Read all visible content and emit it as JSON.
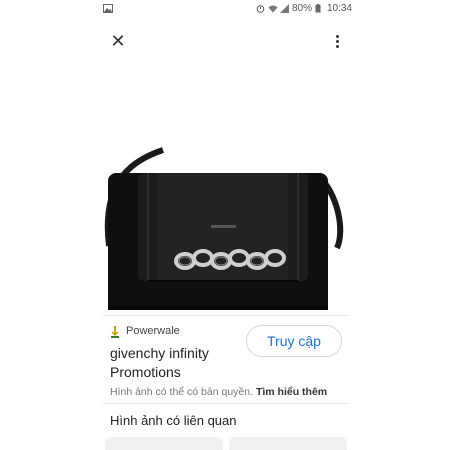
{
  "status_bar": {
    "battery": "80%",
    "time": "10:34"
  },
  "product": {
    "source_name": "Powerwale",
    "visit_label": "Truy cập",
    "title": "givenchy infinity Promotions",
    "copyright_text": "Hình ảnh có thể có bản quyền.",
    "learn_more": "Tìm hiểu thêm"
  },
  "related": {
    "heading": "Hình ảnh có liên quan"
  },
  "colors": {
    "accent": "#1a73e8",
    "bag": "#111111",
    "chain": "#c8c8c8"
  },
  "icons": [
    "image-icon",
    "alarm-icon",
    "wifi-icon",
    "signal-icon",
    "battery-icon",
    "close-icon",
    "more-vert-icon",
    "favicon-icon"
  ]
}
